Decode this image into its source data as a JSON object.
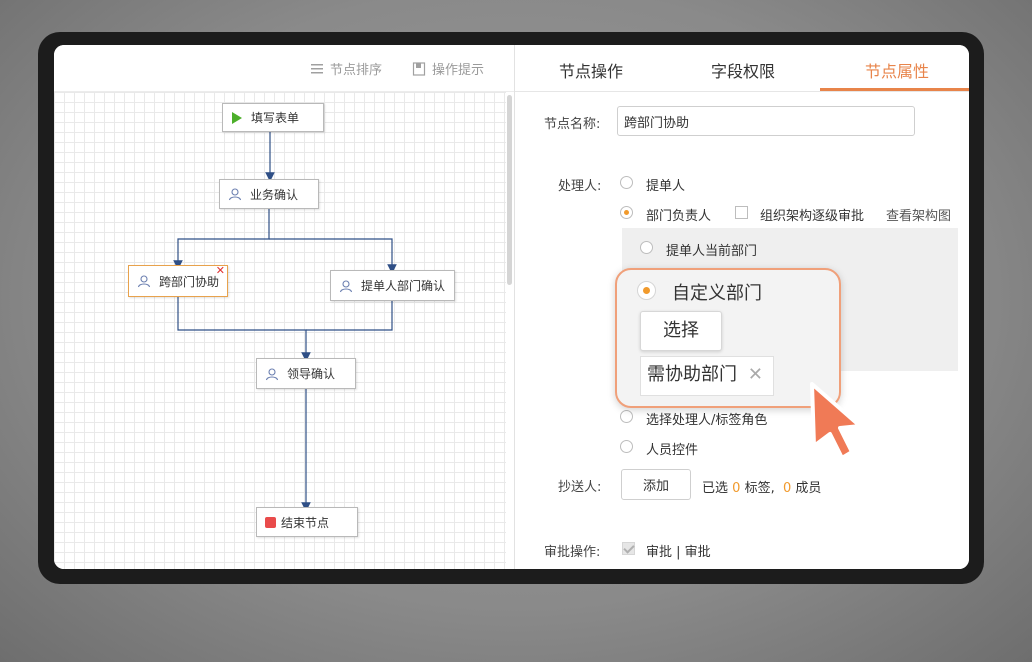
{
  "left_toolbar": {
    "sort_label": "节点排序",
    "tips_label": "操作提示"
  },
  "flow": {
    "start": "填写表单",
    "business_confirm": "业务确认",
    "cross_dept": "跨部门协助",
    "submitter_dept_confirm": "提单人部门确认",
    "leader_confirm": "领导确认",
    "end": "结束节点"
  },
  "tabs": {
    "node_ops": "节点操作",
    "field_perms": "字段权限",
    "node_props": "节点属性",
    "active": "节点属性"
  },
  "props": {
    "node_name_label": "节点名称:",
    "node_name_value": "跨部门协助",
    "handler_label": "处理人:",
    "opt_submitter": "提单人",
    "opt_dept_head": "部门负责人",
    "opt_org_level": "组织架构逐级审批",
    "view_org_chart": "查看架构图",
    "sub_submitter_dept": "提单人当前部门",
    "opt_select_role": "选择处理人/标签角色",
    "opt_person_ctrl": "人员控件",
    "cc_label": "抄送人:",
    "add_button": "添加",
    "selected_prefix": "已选",
    "tag_count": "0",
    "tag_suffix": "标签,",
    "member_count": "0",
    "member_suffix": "成员",
    "approve_ops_label": "审批操作:",
    "approve_text": "审批 | 审批"
  },
  "zoom_callout": {
    "custom_dept": "自定义部门",
    "select_button": "选择",
    "tag": "需协助部门",
    "tag_close": "✕"
  },
  "colors": {
    "accent": "#e8844a",
    "radio_on": "#f19a2c",
    "flow_line": "#2f4f86",
    "end_node": "#e94b4b",
    "start_play": "#4caf2a"
  }
}
